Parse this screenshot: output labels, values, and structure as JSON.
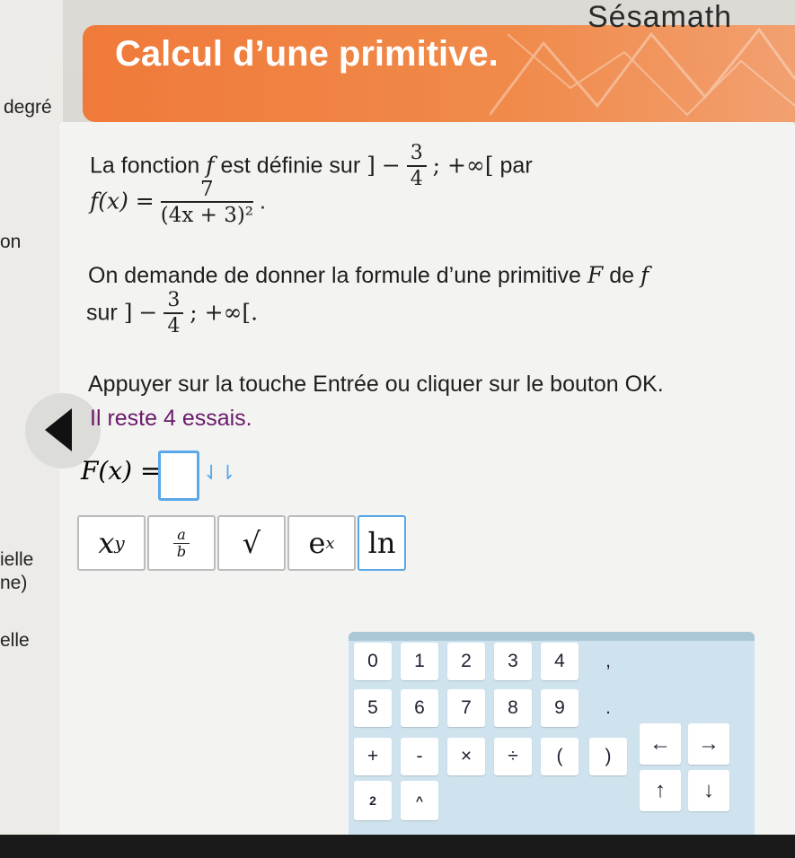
{
  "app": {
    "logo": "Sésamath"
  },
  "exercise": {
    "title": "Calcul d’une primitive.",
    "intro_prefix": "La fonction",
    "intro_middle": "est définie sur",
    "intro_suffix": "par",
    "fn_name": "f",
    "interval_open": "]",
    "interval_minus": "−",
    "interval_num": "3",
    "interval_den": "4",
    "interval_rest": "; +∞[",
    "formula_lhs": "f(x) =",
    "formula_num": "7",
    "formula_den": "(4x + 3)²",
    "formula_end": ".",
    "demand_text": "On demande de donner la formule d’une primitive",
    "primitive_name": "F",
    "demand_de": "de",
    "demand_sur": "sur",
    "interval_rest2": "; +∞[.",
    "instruction": "Appuyer sur la touche Entrée ou cliquer sur le bouton OK.",
    "tries": "Il reste 4 essais.",
    "answer_label": "F(x) =",
    "answer_arrows": "⇃⇂"
  },
  "side_fragments": {
    "degre": "degré",
    "on": "on",
    "ielle": "ielle",
    "ne": "ne)",
    "elle": "elle"
  },
  "function_buttons": [
    {
      "label": "x^y",
      "base": "x",
      "sup": "y"
    },
    {
      "label": "a/b",
      "num": "a",
      "den": "b"
    },
    {
      "label": "√"
    },
    {
      "label": "e^x",
      "base": "e",
      "sup": "x"
    },
    {
      "label": "ln"
    }
  ],
  "keypad": {
    "row1": [
      "0",
      "1",
      "2",
      "3",
      "4",
      ","
    ],
    "row2": [
      "5",
      "6",
      "7",
      "8",
      "9",
      "."
    ],
    "row3": [
      "+",
      "-",
      "×",
      "÷",
      "(",
      ")"
    ],
    "arrows": [
      "←",
      "→",
      "↑",
      "↓"
    ],
    "row4": [
      "2",
      "^"
    ]
  },
  "colors": {
    "header": "#f07a3a",
    "accent": "#5aa8e8",
    "tries": "#6a1a6a"
  }
}
